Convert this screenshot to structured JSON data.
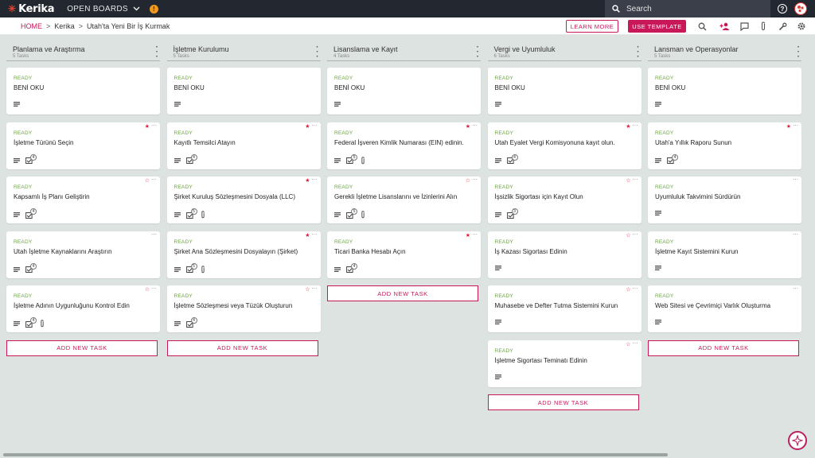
{
  "topbar": {
    "logo": "Kerika",
    "open_boards": "OPEN BOARDS",
    "notif_count": "!",
    "search_placeholder": "Search"
  },
  "breadcrumb": {
    "home": "HOME",
    "org": "Kerika",
    "board": "Utah'ta Yeni Bir İş Kurmak"
  },
  "actions": {
    "learn_more": "LEARN MORE",
    "use_template": "USE TEMPLATE"
  },
  "colors": {
    "accent": "#c8185a",
    "ready": "#69a53c",
    "star": "#e1213b",
    "topbar": "#23272f"
  },
  "add_task_label": "ADD NEW TASK",
  "columns": [
    {
      "title": "Planlama ve Araştırma",
      "count": "5 Tasks",
      "cards": [
        {
          "status": "READY",
          "title": "BENİ OKU",
          "star": "none",
          "checklist": "",
          "attach": false
        },
        {
          "status": "READY",
          "title": "İşletme Türünü Seçin",
          "star": "filled",
          "checklist": "4",
          "attach": false
        },
        {
          "status": "READY",
          "title": "Kapsamlı İş Planı Geliştirin",
          "star": "outline",
          "checklist": "4",
          "attach": false
        },
        {
          "status": "READY",
          "title": "Utah İşletme Kaynaklarını Araştırın",
          "star": "none",
          "checklist": "4",
          "attach": false
        },
        {
          "status": "READY",
          "title": "İşletme Adının Uygunluğunu Kontrol Edin",
          "star": "outline",
          "checklist": "4",
          "attach": true
        }
      ]
    },
    {
      "title": "İşletme Kurulumu",
      "count": "5 Tasks",
      "cards": [
        {
          "status": "READY",
          "title": "BENİ OKU",
          "star": "none",
          "checklist": "",
          "attach": false
        },
        {
          "status": "READY",
          "title": "Kayıtlı Temsilci Atayın",
          "star": "filled",
          "checklist": "4",
          "attach": false
        },
        {
          "status": "READY",
          "title": "Şirket Kuruluş Sözleşmesini Dosyala (LLC)",
          "star": "filled",
          "checklist": "5",
          "attach": true
        },
        {
          "status": "READY",
          "title": "Şirket Ana Sözleşmesini Dosyalayın (Şirket)",
          "star": "filled",
          "checklist": "5",
          "attach": true
        },
        {
          "status": "READY",
          "title": "İşletme Sözleşmesi veya Tüzük Oluşturun",
          "star": "outline",
          "checklist": "4",
          "attach": false
        }
      ]
    },
    {
      "title": "Lisanslama ve Kayıt",
      "count": "4 Tasks",
      "cards": [
        {
          "status": "READY",
          "title": "BENİ OKU",
          "star": "none",
          "checklist": "",
          "attach": false
        },
        {
          "status": "READY",
          "title": "Federal İşveren Kimlik Numarası (EIN) edinin.",
          "star": "filled",
          "checklist": "5",
          "attach": true
        },
        {
          "status": "READY",
          "title": "Gerekli İşletme Lisanslarını ve İzinlerini Alın",
          "star": "outline",
          "checklist": "5",
          "attach": true
        },
        {
          "status": "READY",
          "title": "Ticari Banka Hesabı Açın",
          "star": "filled",
          "checklist": "4",
          "attach": false
        }
      ]
    },
    {
      "title": "Vergi ve Uyumluluk",
      "count": "6 Tasks",
      "cards": [
        {
          "status": "READY",
          "title": "BENİ OKU",
          "star": "none",
          "checklist": "",
          "attach": false
        },
        {
          "status": "READY",
          "title": "Utah Eyalet Vergi Komisyonuna kayıt olun.",
          "star": "filled",
          "checklist": "4",
          "attach": false
        },
        {
          "status": "READY",
          "title": "İşsizlik Sigortası için Kayıt Olun",
          "star": "outline",
          "checklist": "3",
          "attach": false
        },
        {
          "status": "READY",
          "title": "İş Kazası Sigortası Edinin",
          "star": "outline",
          "checklist": "",
          "attach": false
        },
        {
          "status": "READY",
          "title": "Muhasebe ve Defter Tutma Sistemini Kurun",
          "star": "outline",
          "checklist": "",
          "attach": false
        },
        {
          "status": "READY",
          "title": "İşletme Sigortası Teminatı Edinin",
          "star": "outline",
          "checklist": "",
          "attach": false
        }
      ]
    },
    {
      "title": "Lansman ve Operasyonlar",
      "count": "5 Tasks",
      "cards": [
        {
          "status": "READY",
          "title": "BENİ OKU",
          "star": "none",
          "checklist": "",
          "attach": false
        },
        {
          "status": "READY",
          "title": "Utah'a Yıllık Raporu Sunun",
          "star": "filled",
          "checklist": "4",
          "attach": false
        },
        {
          "status": "READY",
          "title": "Uyumluluk Takvimini Sürdürün",
          "star": "none",
          "checklist": "",
          "attach": false
        },
        {
          "status": "READY",
          "title": "İşletme Kayıt Sistemini Kurun",
          "star": "none",
          "checklist": "",
          "attach": false
        },
        {
          "status": "READY",
          "title": "Web Sitesi ve Çevrimiçi Varlık Oluşturma",
          "star": "none",
          "checklist": "",
          "attach": false
        }
      ]
    }
  ]
}
